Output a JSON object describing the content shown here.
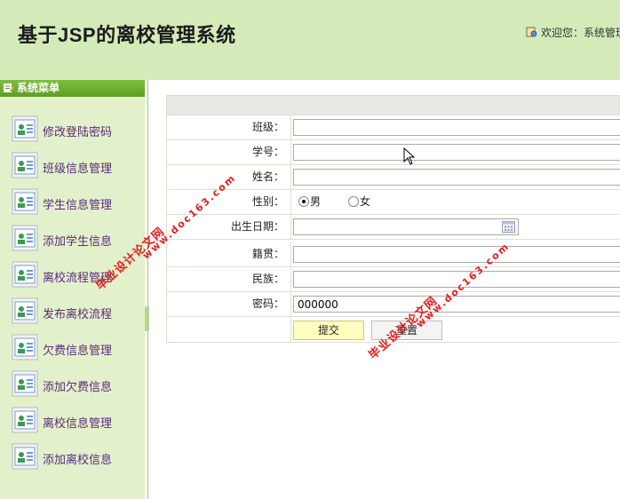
{
  "header": {
    "title": "基于JSP的离校管理系统",
    "welcome": "欢迎您：系统管理员"
  },
  "sidebar": {
    "header": "系统菜单",
    "items": [
      {
        "label": "修改登陆密码"
      },
      {
        "label": "班级信息管理"
      },
      {
        "label": "学生信息管理"
      },
      {
        "label": "添加学生信息"
      },
      {
        "label": "离校流程管理"
      },
      {
        "label": "发布离校流程"
      },
      {
        "label": "欠费信息管理"
      },
      {
        "label": "添加欠费信息"
      },
      {
        "label": "离校信息管理"
      },
      {
        "label": "添加离校信息"
      }
    ]
  },
  "form": {
    "class_label": "班级：",
    "student_no_label": "学号：",
    "name_label": "姓名：",
    "gender_label": "性别：",
    "gender_male": "男",
    "gender_female": "女",
    "gender_selected": "男",
    "birth_label": "出生日期：",
    "native_label": "籍贯：",
    "ethnic_label": "民族：",
    "password_label": "密码：",
    "password_value": "000000",
    "submit_label": "提交",
    "reset_label": "重置"
  },
  "watermark": {
    "title": "毕业设计论文网",
    "url": "www.doc163.com"
  }
}
